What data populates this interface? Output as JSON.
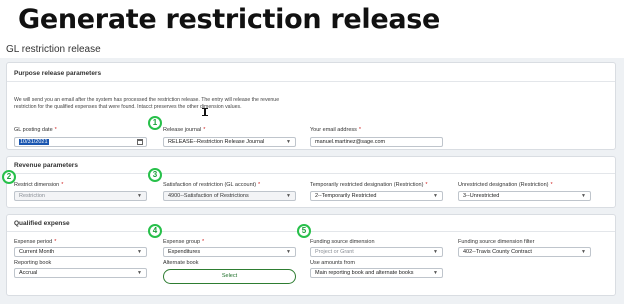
{
  "banner": {
    "title": "Generate restriction release"
  },
  "page": {
    "title": "GL restriction release"
  },
  "purpose": {
    "title": "Purpose release parameters",
    "description": "We will send you an email after the system has processed the restriction release. The entry will release the revenue restriction for the qualified expenses that were found. Intacct preserves the other dimension values.",
    "posting_date": {
      "label": "GL posting date",
      "value": "10/31/2021"
    },
    "release_journal": {
      "label": "Release journal",
      "value": "RELEASE--Restriction Release Journal"
    },
    "email": {
      "label": "Your email address",
      "value": "manuel.martinez@sage.com"
    }
  },
  "revenue": {
    "title": "Revenue parameters",
    "restrict_dimension": {
      "label": "Restrict dimension",
      "value": "Restriction"
    },
    "satisfaction": {
      "label": "Satisfaction of restriction (GL account)",
      "value": "4900--Satisfaction of Restrictions"
    },
    "temp_restricted": {
      "label": "Temporarily restricted designation (Restriction)",
      "value": "2--Temporarily Restricted"
    },
    "unrestricted": {
      "label": "Unrestricted designation (Restriction)",
      "value": "3--Unrestricted"
    }
  },
  "qualified": {
    "title": "Qualified expense",
    "expense_period": {
      "label": "Expense period",
      "value": "Current Month"
    },
    "expense_group": {
      "label": "Expense group",
      "value": "Expenditures"
    },
    "funding_dimension": {
      "label": "Funding source dimension",
      "value": "Project or Grant"
    },
    "funding_filter": {
      "label": "Funding source dimension filter",
      "value": "402--Travis County Contract"
    },
    "reporting_book": {
      "label": "Reporting book",
      "value": "Accrual"
    },
    "alternate_book": {
      "label": "Alternate book",
      "button": "Select"
    },
    "use_amounts": {
      "label": "Use amounts from",
      "value": "Main reporting book and alternate books"
    }
  },
  "markers": [
    "1",
    "2",
    "3",
    "4",
    "5"
  ],
  "colors": {
    "marker": "#27c04a",
    "required": "#d02020",
    "selection": "#1a56b0"
  }
}
